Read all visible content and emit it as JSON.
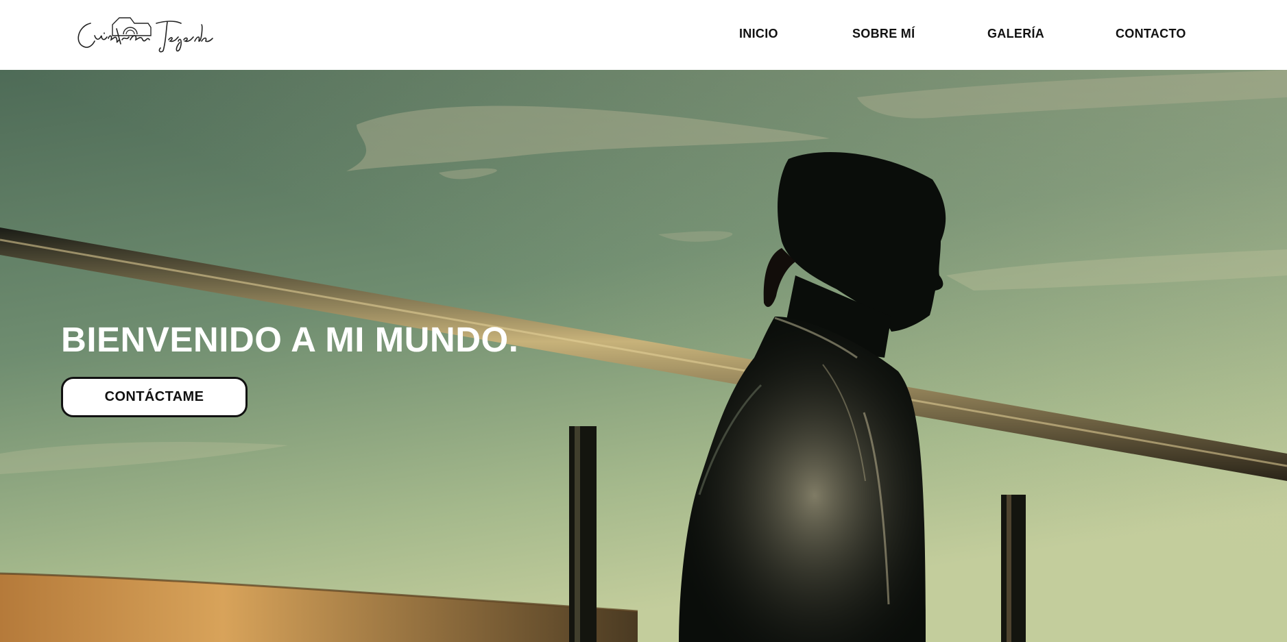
{
  "brand": {
    "logo_text": "Cristian Tejeda",
    "logo_icon": "camera-icon"
  },
  "nav": {
    "items": [
      {
        "label": "INICIO"
      },
      {
        "label": "SOBRE MÍ"
      },
      {
        "label": "GALERÍA"
      },
      {
        "label": "CONTACTO"
      }
    ]
  },
  "hero": {
    "title": "BIENVENIDO A MI MUNDO.",
    "cta_label": "CONTÁCTAME"
  },
  "colors": {
    "text_dark": "#111111",
    "header_bg": "#ffffff",
    "sky_top": "#4f6e5a",
    "sky_bottom": "#b7c79a",
    "silhouette": "#0a0d0a"
  }
}
